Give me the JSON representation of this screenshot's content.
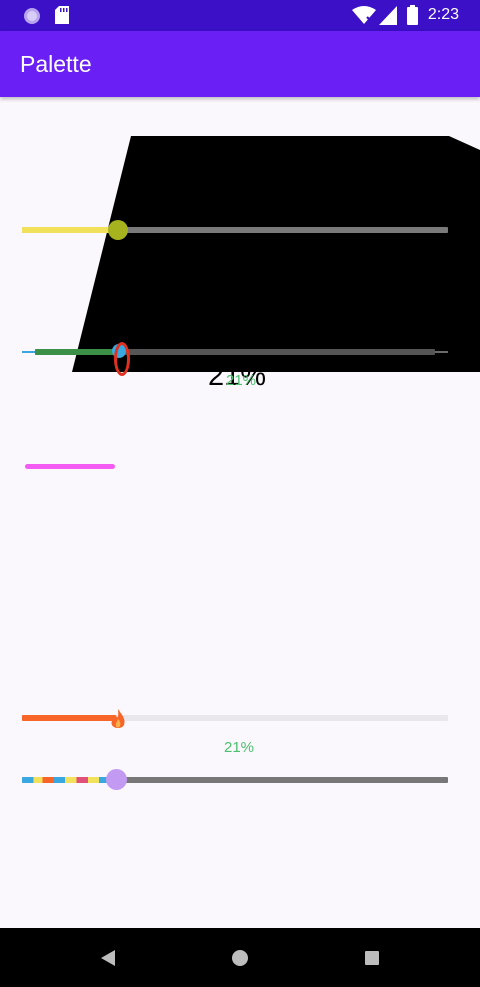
{
  "status_bar": {
    "time": "2:23"
  },
  "app_bar": {
    "title": "Palette"
  },
  "overlay": {
    "big_percent": "21%",
    "small_percent": "21%"
  },
  "sliders": {
    "yellow": {
      "value": 0.22
    },
    "green_blue": {
      "value": 0.22
    },
    "magenta": {
      "value": 0.22
    },
    "orange": {
      "value": 0.22
    },
    "rainbow": {
      "value": 0.22
    }
  },
  "labels": {
    "orange_percent": "21%"
  },
  "colors": {
    "status_bar": "#3b10c6",
    "app_bar": "#6a1ff5",
    "yellow": "#f2e25b",
    "green": "#3b8f46",
    "magenta": "#f25cf2",
    "orange": "#f76528",
    "thumb_purple": "#c39af2",
    "percent_green": "#4dbf6e"
  },
  "icons": {
    "status": [
      "circle-icon",
      "sd-card-icon",
      "wifi-icon",
      "signal-icon",
      "battery-icon"
    ],
    "nav": [
      "back-icon",
      "home-icon",
      "recents-icon"
    ]
  }
}
